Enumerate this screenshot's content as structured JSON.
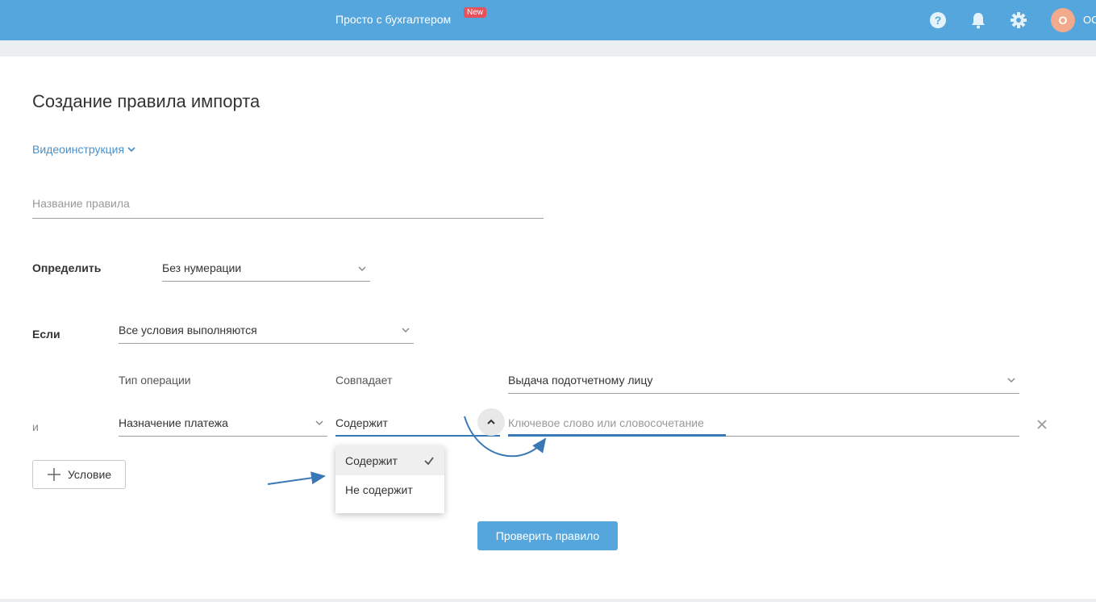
{
  "header": {
    "brand": "Просто с бухгалтером",
    "badge": "New",
    "icons": [
      "help-icon",
      "bell-icon",
      "gear-icon"
    ],
    "avatar_letter": "О",
    "user_name": "ОС",
    "bg_color": "#55a6dc"
  },
  "page": {
    "title": "Создание правила импорта",
    "video_link": "Видеоинструкция",
    "rule_name_placeholder": "Название правила"
  },
  "define": {
    "label": "Определить",
    "value": "Без нумерации"
  },
  "if_block": {
    "label": "Если",
    "value": "Все условия выполняются"
  },
  "condition1": {
    "field": "Тип операции",
    "operator": "Совпадает",
    "value": "Выдача подотчетному лицу"
  },
  "condition2": {
    "conjunction": "и",
    "field": "Назначение платежа",
    "operator": "Содержит",
    "value_placeholder": "Ключевое слово или словосочетание"
  },
  "operator_dropdown": {
    "options": [
      "Содержит",
      "Не содержит"
    ],
    "selected": "Содержит"
  },
  "buttons": {
    "add_condition": "Условие",
    "check_rule": "Проверить правило"
  },
  "colors": {
    "accent": "#55a6dc",
    "link": "#4a90c8",
    "badge": "#e8505b",
    "arrow": "#3a78b5"
  }
}
